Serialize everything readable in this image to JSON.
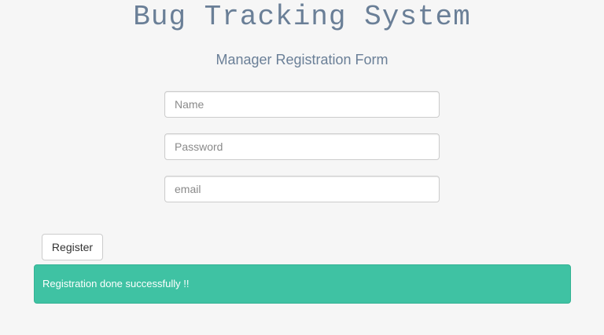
{
  "header": {
    "app_title": "Bug Tracking System",
    "form_title": "Manager Registration Form"
  },
  "form": {
    "name": {
      "placeholder": "Name",
      "value": ""
    },
    "password": {
      "placeholder": "Password",
      "value": ""
    },
    "email": {
      "placeholder": "email",
      "value": ""
    },
    "register_label": "Register"
  },
  "alert": {
    "message": "Registration done successfully !!",
    "color": "#3fc2a3"
  },
  "colors": {
    "background": "#f6f6f6",
    "title": "#6a7f97"
  }
}
